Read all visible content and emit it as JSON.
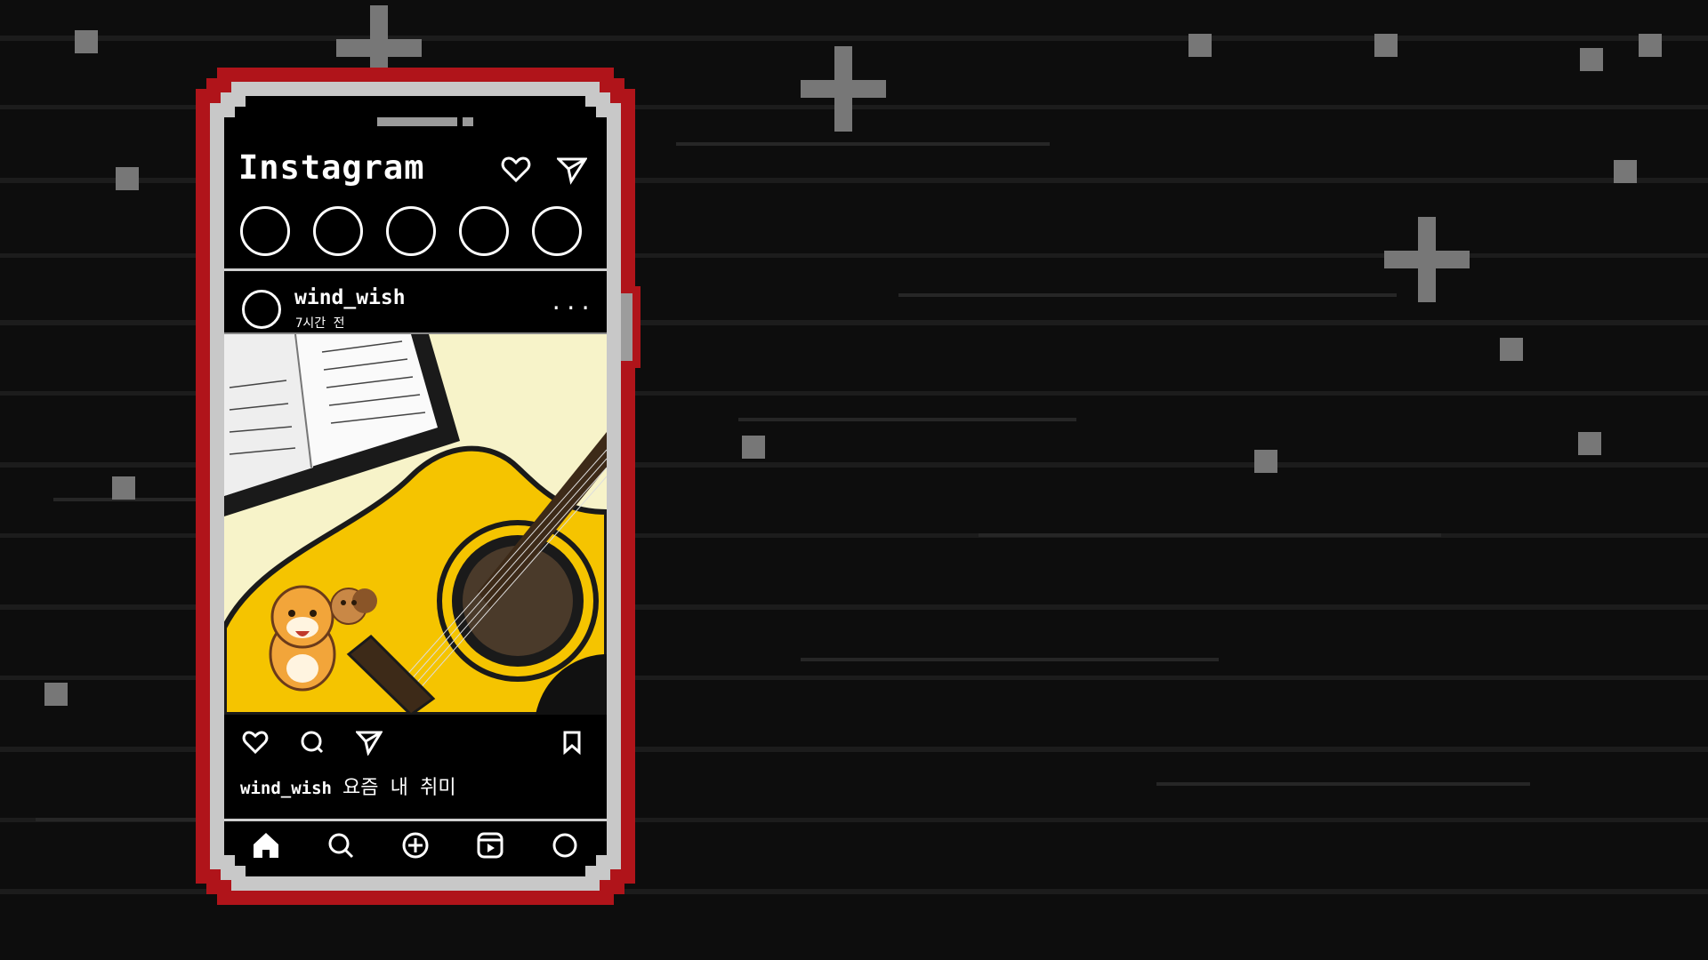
{
  "app": {
    "title": "Instagram"
  },
  "header_icons": [
    "heart-outline-icon",
    "paper-plane-icon"
  ],
  "stories_count": 5,
  "post": {
    "username": "wind_wish",
    "time_ago": "7시간 전",
    "more_label": "...",
    "caption_user": "wind_wish",
    "caption_text": "요즘 내 취미",
    "image_subject": "acoustic guitar, music book, tiger and squirrel characters"
  },
  "post_actions": [
    "heart-icon",
    "comment-icon",
    "share-icon",
    "bookmark-icon"
  ],
  "bottom_nav": [
    "home-icon",
    "search-icon",
    "add-post-icon",
    "reels-icon",
    "profile-icon"
  ],
  "colors": {
    "phone_frame": "#b0141a",
    "screen": "#000000",
    "background": "#0b0b0b",
    "guitar": "#f5c400"
  }
}
